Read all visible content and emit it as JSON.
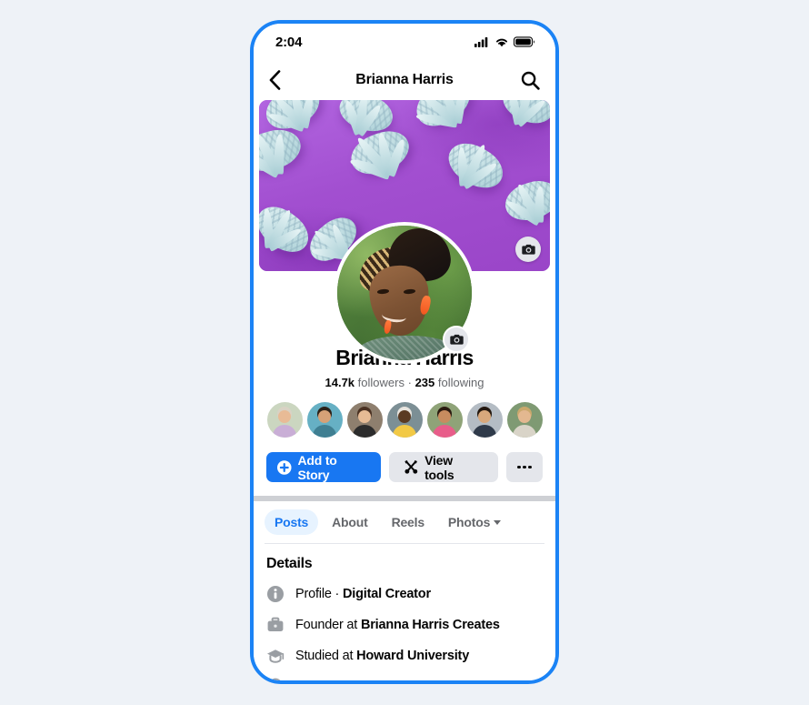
{
  "status_bar": {
    "time": "2:04",
    "signal_icon": "cellular-signal-icon",
    "wifi_icon": "wifi-icon",
    "battery_icon": "battery-icon"
  },
  "nav": {
    "back_icon": "back-chevron-icon",
    "title": "Brianna Harris",
    "search_icon": "search-icon"
  },
  "cover": {
    "description": "purple background with pale blue pineapples",
    "background_color": "#a24fd0",
    "pineapple_color": "#c5e0e4",
    "camera_icon": "camera-icon"
  },
  "profile": {
    "avatar_description": "woman with braided updo and orange earrings",
    "avatar_camera_icon": "camera-icon",
    "name": "Brianna Harris",
    "followers_count": "14.7k",
    "followers_label": "followers",
    "stats_separator": "·",
    "following_count": "235",
    "following_label": "following"
  },
  "friends": [
    {
      "name": "friend-avatar-1",
      "skin": "#e8bb96",
      "hair": "#d9d2c4",
      "shirt": "#c9aed6",
      "bg": "#cbd6c0"
    },
    {
      "name": "friend-avatar-2",
      "skin": "#d6a177",
      "hair": "#2c2118",
      "shirt": "#3f7f92",
      "bg": "#66b0c4"
    },
    {
      "name": "friend-avatar-3",
      "skin": "#e6bb95",
      "hair": "#4a3122",
      "shirt": "#2c2c2c",
      "bg": "#8e7f6e"
    },
    {
      "name": "friend-avatar-4",
      "skin": "#5a3a22",
      "hair": "#e8e4de",
      "shirt": "#f2c945",
      "bg": "#7c8f95"
    },
    {
      "name": "friend-avatar-5",
      "skin": "#c78c5f",
      "hair": "#2a1a10",
      "shirt": "#e85d8a",
      "bg": "#8fa378"
    },
    {
      "name": "friend-avatar-6",
      "skin": "#d8a87c",
      "hair": "#24180f",
      "shirt": "#2f3a4a",
      "bg": "#b4bcc4"
    },
    {
      "name": "friend-avatar-7",
      "skin": "#e3b890",
      "hair": "#caa86c",
      "shirt": "#d9d4c8",
      "bg": "#7f9a73"
    }
  ],
  "actions": {
    "add_to_story": {
      "label": "Add to Story",
      "icon": "plus-circle-icon",
      "color": "#1877f2"
    },
    "view_tools": {
      "label": "View tools",
      "icon": "tools-icon",
      "color": "#e4e6eb"
    },
    "more": {
      "icon": "more-dots-icon"
    }
  },
  "tabs": [
    {
      "label": "Posts",
      "active": true,
      "has_caret": false
    },
    {
      "label": "About",
      "active": false,
      "has_caret": false
    },
    {
      "label": "Reels",
      "active": false,
      "has_caret": false
    },
    {
      "label": "Photos",
      "active": false,
      "has_caret": true
    }
  ],
  "details": {
    "title": "Details",
    "rows": [
      {
        "icon": "info-circle-icon",
        "prefix": "Profile · ",
        "value": "Digital Creator"
      },
      {
        "icon": "briefcase-icon",
        "prefix": "Founder at ",
        "value": "Brianna Harris Creates"
      },
      {
        "icon": "graduation-cap-icon",
        "prefix": "Studied at ",
        "value": "Howard University"
      },
      {
        "icon": "location-icon",
        "prefix": "",
        "value": ""
      }
    ]
  }
}
